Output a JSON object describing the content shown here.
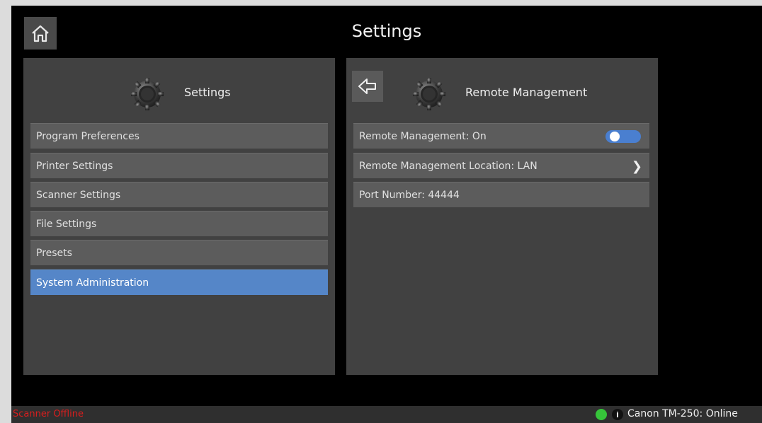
{
  "header": {
    "title": "Settings",
    "home_icon": "home-icon"
  },
  "left_panel": {
    "title": "Settings",
    "icon": "gear-icon",
    "items": [
      {
        "label": "Program Preferences",
        "selected": false
      },
      {
        "label": "Printer Settings",
        "selected": false
      },
      {
        "label": "Scanner Settings",
        "selected": false
      },
      {
        "label": "File Settings",
        "selected": false
      },
      {
        "label": "Presets",
        "selected": false
      },
      {
        "label": "System Administration",
        "selected": true
      }
    ]
  },
  "right_panel": {
    "title": "Remote Management",
    "icon": "gear-icon",
    "back_icon": "back-arrow-icon",
    "items": [
      {
        "label": "Remote Management: On",
        "control": "toggle",
        "value": true
      },
      {
        "label": "Remote Management Location: LAN",
        "control": "chevron"
      },
      {
        "label": "Port Number: 44444",
        "control": "none"
      }
    ]
  },
  "status_bar": {
    "scanner_status": "Scanner Offline",
    "printer_status": "Canon TM-250: Online",
    "info_icon_text": "i"
  },
  "colors": {
    "background": "#000000",
    "panel": "#414141",
    "item": "#5c5c5c",
    "selected": "#5586c8",
    "toggle_on": "#4a7fd0",
    "status_offline": "#d81e1e",
    "status_online": "#36c43a"
  }
}
